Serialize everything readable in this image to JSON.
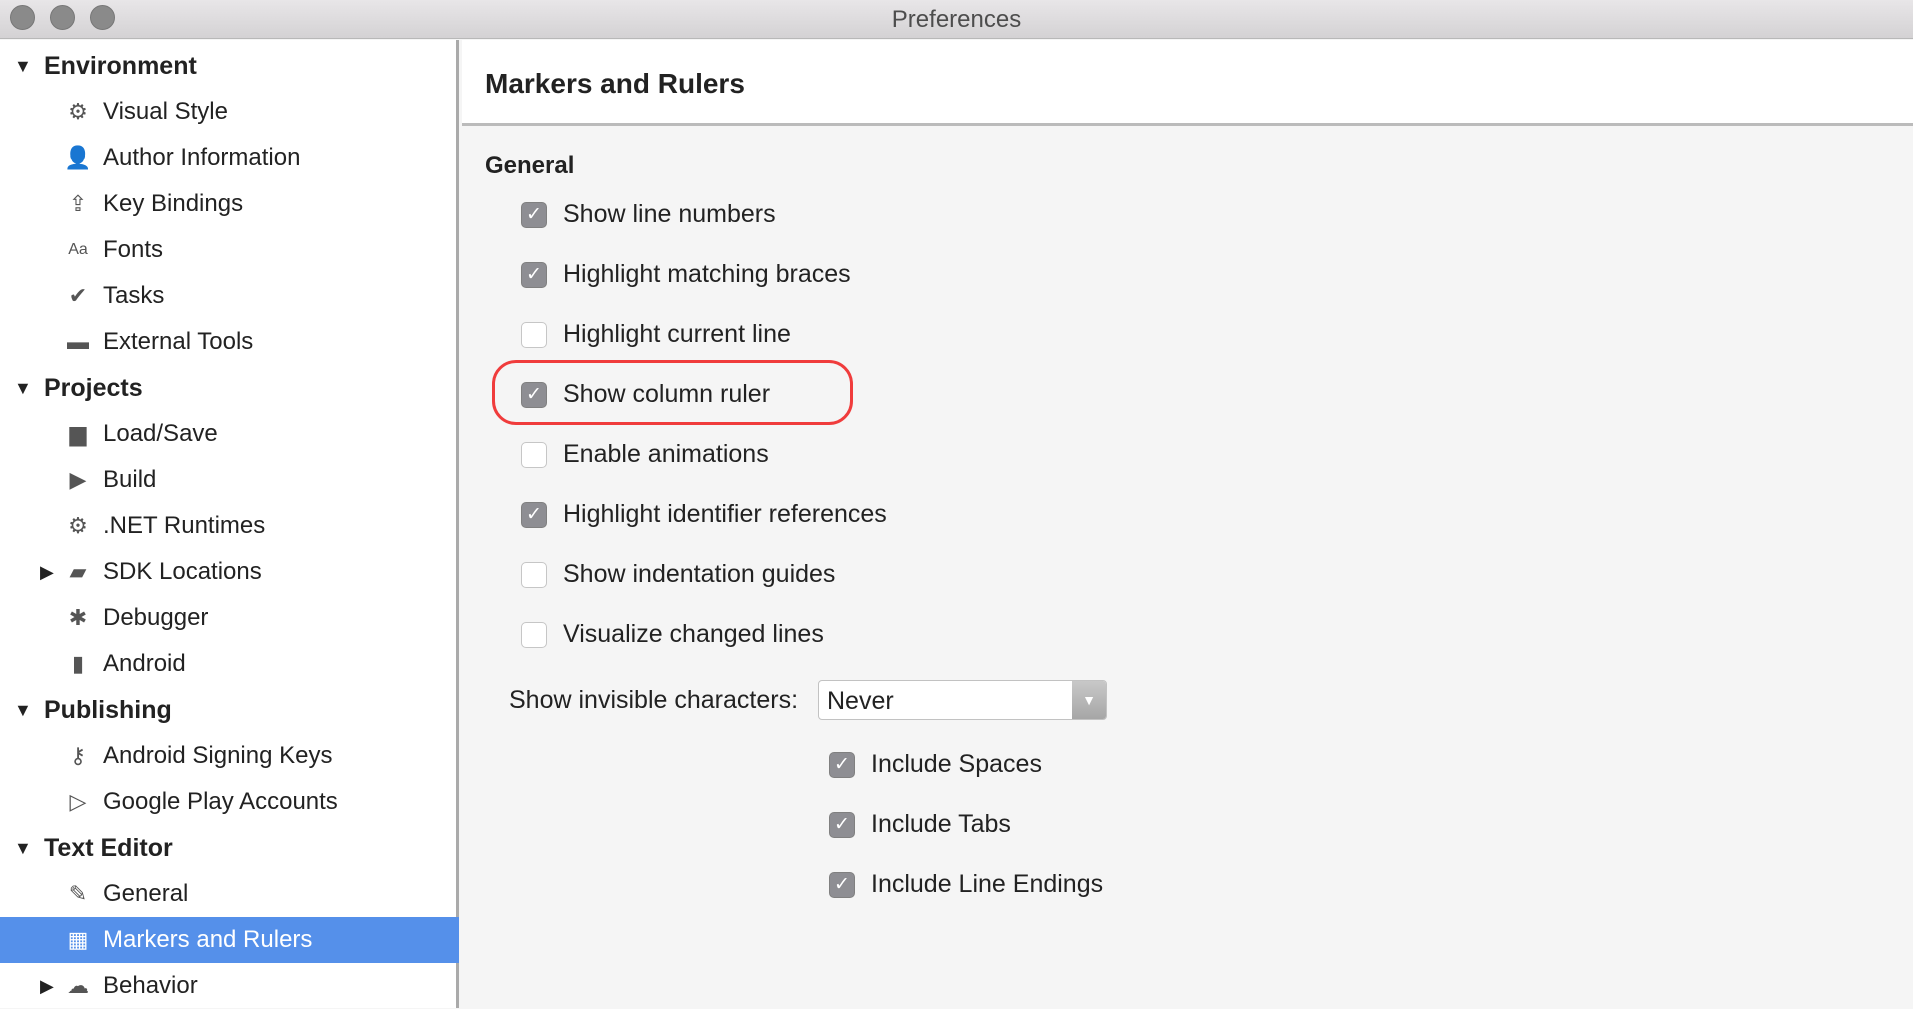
{
  "window": {
    "title": "Preferences"
  },
  "sidebar": {
    "items": [
      {
        "label": "Environment",
        "type": "category",
        "expanded": true
      },
      {
        "label": "Visual Style",
        "icon": "gear-icon",
        "glyph": "⚙"
      },
      {
        "label": "Author Information",
        "icon": "user-icon",
        "glyph": "👤"
      },
      {
        "label": "Key Bindings",
        "icon": "keyboard-upload-icon",
        "glyph": "⇪"
      },
      {
        "label": "Fonts",
        "icon": "fonts-icon",
        "glyph": "Aa"
      },
      {
        "label": "Tasks",
        "icon": "checkmark-icon",
        "glyph": "✔"
      },
      {
        "label": "External Tools",
        "icon": "terminal-icon",
        "glyph": "▬"
      },
      {
        "label": "Projects",
        "type": "category",
        "expanded": true
      },
      {
        "label": "Load/Save",
        "icon": "disk-icon",
        "glyph": "▆"
      },
      {
        "label": "Build",
        "icon": "build-icon",
        "glyph": "▶"
      },
      {
        "label": ".NET Runtimes",
        "icon": "gear-icon",
        "glyph": "⚙"
      },
      {
        "label": "SDK Locations",
        "icon": "folder-icon",
        "glyph": "▰",
        "expandable": true
      },
      {
        "label": "Debugger",
        "icon": "bug-icon",
        "glyph": "✱"
      },
      {
        "label": "Android",
        "icon": "android-icon",
        "glyph": "▮"
      },
      {
        "label": "Publishing",
        "type": "category",
        "expanded": true
      },
      {
        "label": "Android Signing Keys",
        "icon": "key-icon",
        "glyph": "⚷"
      },
      {
        "label": "Google Play Accounts",
        "icon": "play-icon",
        "glyph": "▷"
      },
      {
        "label": "Text Editor",
        "type": "category",
        "expanded": true
      },
      {
        "label": "General",
        "icon": "pencil-icon",
        "glyph": "✎"
      },
      {
        "label": "Markers and Rulers",
        "icon": "grid-icon",
        "glyph": "▦",
        "selected": true
      },
      {
        "label": "Behavior",
        "icon": "brain-icon",
        "glyph": "☁",
        "expandable": true
      }
    ]
  },
  "main": {
    "title": "Markers and Rulers",
    "section": "General",
    "options": [
      {
        "label": "Show line numbers",
        "checked": true
      },
      {
        "label": "Highlight matching braces",
        "checked": true
      },
      {
        "label": "Highlight current line",
        "checked": false
      },
      {
        "label": "Show column ruler",
        "checked": true,
        "highlighted": true
      },
      {
        "label": "Enable animations",
        "checked": false
      },
      {
        "label": "Highlight identifier references",
        "checked": true
      },
      {
        "label": "Show indentation guides",
        "checked": false
      },
      {
        "label": "Visualize changed lines",
        "checked": false
      }
    ],
    "invisible": {
      "label": "Show invisible characters:",
      "value": "Never"
    },
    "sub_options": [
      {
        "label": "Include Spaces",
        "checked": true
      },
      {
        "label": "Include Tabs",
        "checked": true
      },
      {
        "label": "Include Line Endings",
        "checked": true
      }
    ]
  },
  "colors": {
    "selection": "#5590ea",
    "highlight_ring": "#f03c3c",
    "checkbox_checked": "#8e8e93"
  }
}
